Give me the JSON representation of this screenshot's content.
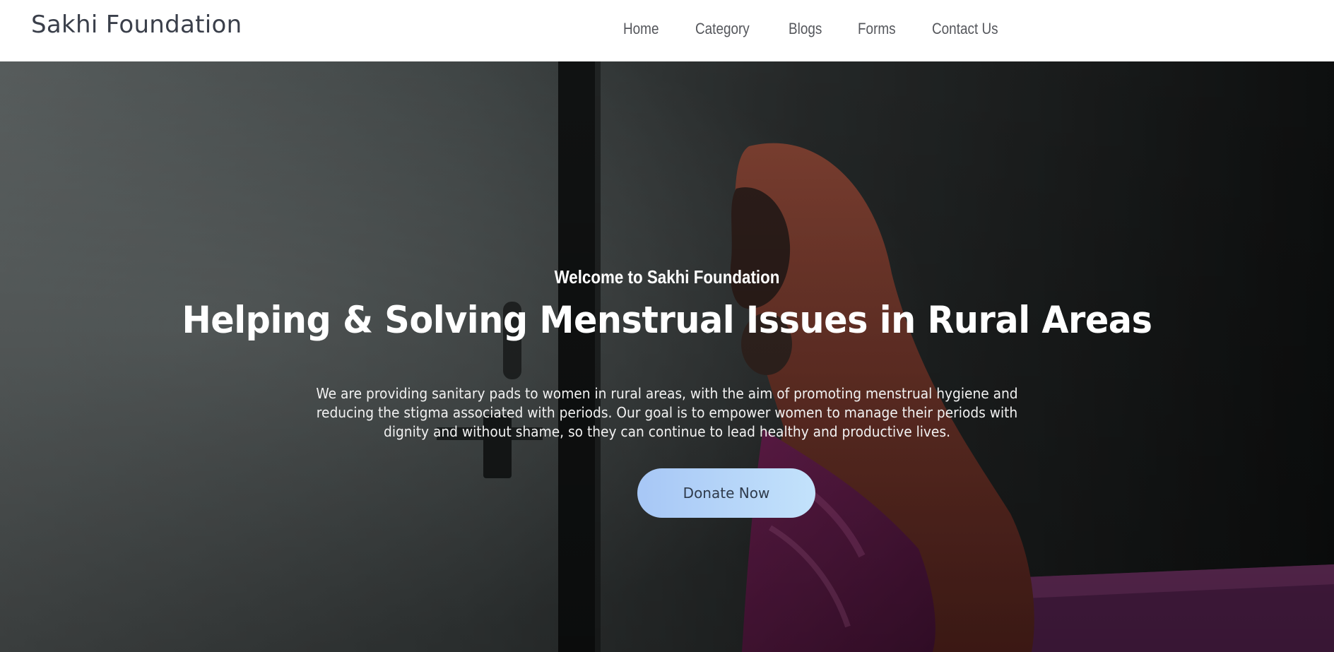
{
  "header": {
    "brand": "Sakhi Foundation",
    "nav": [
      {
        "label": "Home"
      },
      {
        "label": "Category"
      },
      {
        "label": "Blogs"
      },
      {
        "label": "Forms"
      },
      {
        "label": "Contact Us"
      }
    ]
  },
  "hero": {
    "eyebrow": "Welcome to Sakhi Foundation",
    "headline": "Helping & Solving Menstrual Issues in Rural Areas",
    "description": "We are providing sanitary pads to women in rural areas, with the aim of promoting menstrual hygiene and reducing the stigma associated with periods. Our goal is to empower women to manage their periods with dignity and without shame, so they can continue to lead healthy and productive lives.",
    "cta_label": "Donate Now"
  },
  "colors": {
    "nav_background": "#ffffff",
    "brand_text": "#3a3f4a",
    "nav_text": "#55575c",
    "button_gradient_start": "#a7c7f6",
    "button_gradient_end": "#c3e2fb"
  }
}
